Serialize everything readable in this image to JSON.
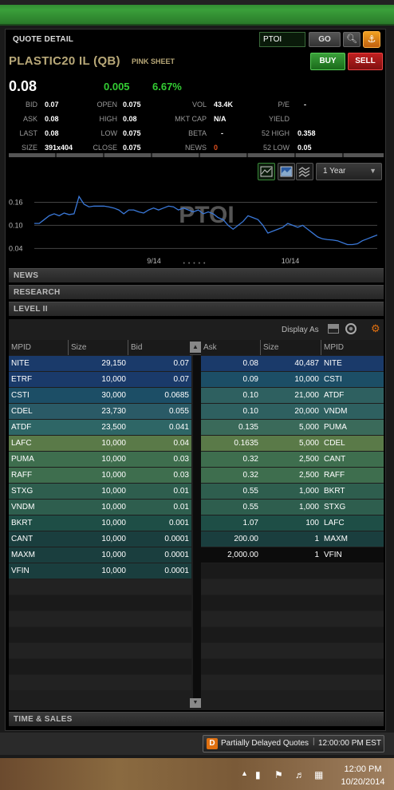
{
  "panel": {
    "title": "QUOTE DETAIL",
    "symbol_input": "PTOI",
    "go_label": "GO",
    "search_icon": "magnifier-icon",
    "link_icon": "chain-link-icon",
    "company": "PLASTIC20 IL (QB)",
    "market": "PINK SHEET",
    "buy_label": "BUY",
    "sell_label": "SELL"
  },
  "quote": {
    "last": "0.08",
    "change": "0.005",
    "change_pct": "6.67%",
    "change_color": "#33cc33",
    "stats": {
      "bid_label": "BID",
      "bid": "0.07",
      "ask_label": "ASK",
      "ask": "0.08",
      "last_label": "LAST",
      "last": "0.08",
      "size_label": "SIZE",
      "size": "391x404",
      "open_label": "OPEN",
      "open": "0.075",
      "high_label": "HIGH",
      "high": "0.08",
      "low_label": "LOW",
      "low": "0.075",
      "close_label": "CLOSE",
      "close": "0.075",
      "vol_label": "VOL",
      "vol": "43.4K",
      "mktcap_label": "MKT CAP",
      "mktcap": "N/A",
      "beta_label": "BETA",
      "beta": "-",
      "news_label": "NEWS",
      "news": "0",
      "pe_label": "P/E",
      "pe": "-",
      "yield_label": "YIELD",
      "yield": "",
      "high52_label": "52 HIGH",
      "high52": "0.358",
      "low52_label": "52 LOW",
      "low52": "0.05"
    }
  },
  "chart_controls": {
    "icons": [
      "line-chart-icon",
      "area-chart-icon",
      "compare-chart-icon"
    ],
    "period": "1 Year"
  },
  "chart_data": {
    "type": "line",
    "watermark": "PTOI",
    "x_ticks": [
      "9/14",
      "10/14"
    ],
    "y_ticks": [
      "0.16",
      "0.10",
      "0.04"
    ],
    "ylim": [
      0.02,
      0.19
    ],
    "grid": true,
    "series": [
      {
        "color": "#3a78d8",
        "values": [
          0.105,
          0.105,
          0.115,
          0.125,
          0.13,
          0.125,
          0.132,
          0.128,
          0.13,
          0.175,
          0.155,
          0.148,
          0.15,
          0.15,
          0.15,
          0.148,
          0.145,
          0.14,
          0.13,
          0.14,
          0.14,
          0.135,
          0.132,
          0.14,
          0.145,
          0.14,
          0.145,
          0.15,
          0.148,
          0.14,
          0.145,
          0.14,
          0.135,
          0.14,
          0.13,
          0.135,
          0.13,
          0.12,
          0.115,
          0.1,
          0.09,
          0.1,
          0.11,
          0.125,
          0.12,
          0.115,
          0.1,
          0.08,
          0.085,
          0.09,
          0.095,
          0.105,
          0.1,
          0.095,
          0.1,
          0.09,
          0.08,
          0.07,
          0.065,
          0.063,
          0.062,
          0.06,
          0.055,
          0.05,
          0.05,
          0.052,
          0.06,
          0.065,
          0.07,
          0.075
        ]
      }
    ]
  },
  "sections": {
    "news": "NEWS",
    "research": "RESEARCH",
    "level2": "LEVEL II",
    "time_sales": "TIME & SALES"
  },
  "level2": {
    "display_as": "Display As",
    "headers": {
      "bid_mpid": "MPID",
      "bid_size": "Size",
      "bid": "Bid",
      "ask": "Ask",
      "ask_size": "Size",
      "ask_mpid": "MPID"
    },
    "bids": [
      {
        "mpid": "NITE",
        "size": "29,150",
        "price": "0.07",
        "color": "#1a3a6a"
      },
      {
        "mpid": "ETRF",
        "size": "10,000",
        "price": "0.07",
        "color": "#1a3a6a"
      },
      {
        "mpid": "CSTI",
        "size": "30,000",
        "price": "0.0685",
        "color": "#1c4e66"
      },
      {
        "mpid": "CDEL",
        "size": "23,730",
        "price": "0.055",
        "color": "#2a5a66"
      },
      {
        "mpid": "ATDF",
        "size": "23,500",
        "price": "0.041",
        "color": "#2e6666"
      },
      {
        "mpid": "LAFC",
        "size": "10,000",
        "price": "0.04",
        "color": "#5a7a48"
      },
      {
        "mpid": "PUMA",
        "size": "10,000",
        "price": "0.03",
        "color": "#3e6e4e"
      },
      {
        "mpid": "RAFF",
        "size": "10,000",
        "price": "0.03",
        "color": "#3e6e4e"
      },
      {
        "mpid": "STXG",
        "size": "10,000",
        "price": "0.01",
        "color": "#2e5e4e"
      },
      {
        "mpid": "VNDM",
        "size": "10,000",
        "price": "0.01",
        "color": "#2e5e4e"
      },
      {
        "mpid": "BKRT",
        "size": "10,000",
        "price": "0.001",
        "color": "#1e4e46"
      },
      {
        "mpid": "CANT",
        "size": "10,000",
        "price": "0.0001",
        "color": "#1a3e3e"
      },
      {
        "mpid": "MAXM",
        "size": "10,000",
        "price": "0.0001",
        "color": "#1a3e3e"
      },
      {
        "mpid": "VFIN",
        "size": "10,000",
        "price": "0.0001",
        "color": "#1a3e3e"
      }
    ],
    "asks": [
      {
        "price": "0.08",
        "size": "40,487",
        "mpid": "NITE",
        "color": "#1a3a6a"
      },
      {
        "price": "0.09",
        "size": "10,000",
        "mpid": "CSTI",
        "color": "#1c4e66"
      },
      {
        "price": "0.10",
        "size": "21,000",
        "mpid": "ATDF",
        "color": "#2e6060"
      },
      {
        "price": "0.10",
        "size": "20,000",
        "mpid": "VNDM",
        "color": "#2e6060"
      },
      {
        "price": "0.135",
        "size": "5,000",
        "mpid": "PUMA",
        "color": "#3a6a5a"
      },
      {
        "price": "0.1635",
        "size": "5,000",
        "mpid": "CDEL",
        "color": "#5a7a48"
      },
      {
        "price": "0.32",
        "size": "2,500",
        "mpid": "CANT",
        "color": "#3e6e4e"
      },
      {
        "price": "0.32",
        "size": "2,500",
        "mpid": "RAFF",
        "color": "#3e6e4e"
      },
      {
        "price": "0.55",
        "size": "1,000",
        "mpid": "BKRT",
        "color": "#2e5e4e"
      },
      {
        "price": "0.55",
        "size": "1,000",
        "mpid": "STXG",
        "color": "#2e5e4e"
      },
      {
        "price": "1.07",
        "size": "100",
        "mpid": "LAFC",
        "color": "#1e4e46"
      },
      {
        "price": "200.00",
        "size": "1",
        "mpid": "MAXM",
        "color": "#1a3e3e"
      },
      {
        "price": "2,000.00",
        "size": "1",
        "mpid": "VFIN",
        "color": "#0c0c0c"
      }
    ]
  },
  "status": {
    "delay_icon": "D",
    "delay_text": "Partially Delayed Quotes",
    "time": "12:00:00 PM EST"
  },
  "taskbar": {
    "time": "12:00 PM",
    "date": "10/20/2014"
  }
}
